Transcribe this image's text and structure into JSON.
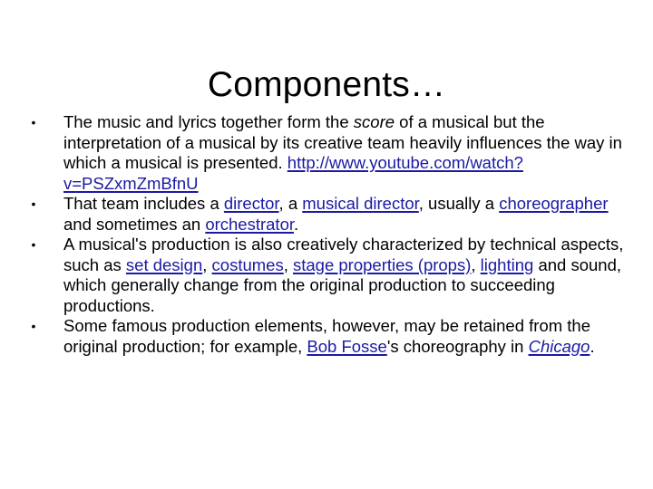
{
  "slide": {
    "title": "Components…"
  },
  "colors": {
    "text": "#000000",
    "link": "#1a1aa6",
    "background": "#ffffff"
  },
  "bullet_icon": "bullet-dot",
  "bullets": [
    {
      "parts": {
        "t1": "The music and lyrics together form the ",
        "em1": "score",
        "t2": " of a musical but the interpretation of a musical by its creative team heavily influences the way in which a musical is presented. ",
        "link1": "http://www.youtube.com/watch?v=PSZxmZmBfnU"
      }
    },
    {
      "parts": {
        "t1": "That team includes a ",
        "link1": "director",
        "t2": ", a ",
        "link2": "musical director",
        "t3": ", usually a ",
        "link3": "choreographer",
        "t4": " and sometimes an ",
        "link4": "orchestrator",
        "t5": "."
      }
    },
    {
      "parts": {
        "t1": "A musical's production is also creatively characterized by technical aspects, such as ",
        "link1": "set design",
        "t2": ", ",
        "link2": "costumes",
        "t3": ", ",
        "link3": "stage properties (props)",
        "t4": ", ",
        "link4": "lighting",
        "t5": " and sound, which generally change from the original production to succeeding productions."
      }
    },
    {
      "parts": {
        "t1": "Some famous production elements, however, may be retained from the original production; for example, ",
        "link1": "Bob Fosse",
        "t2": "'s choreography in ",
        "link2": "Chicago",
        "t3": "."
      }
    }
  ]
}
